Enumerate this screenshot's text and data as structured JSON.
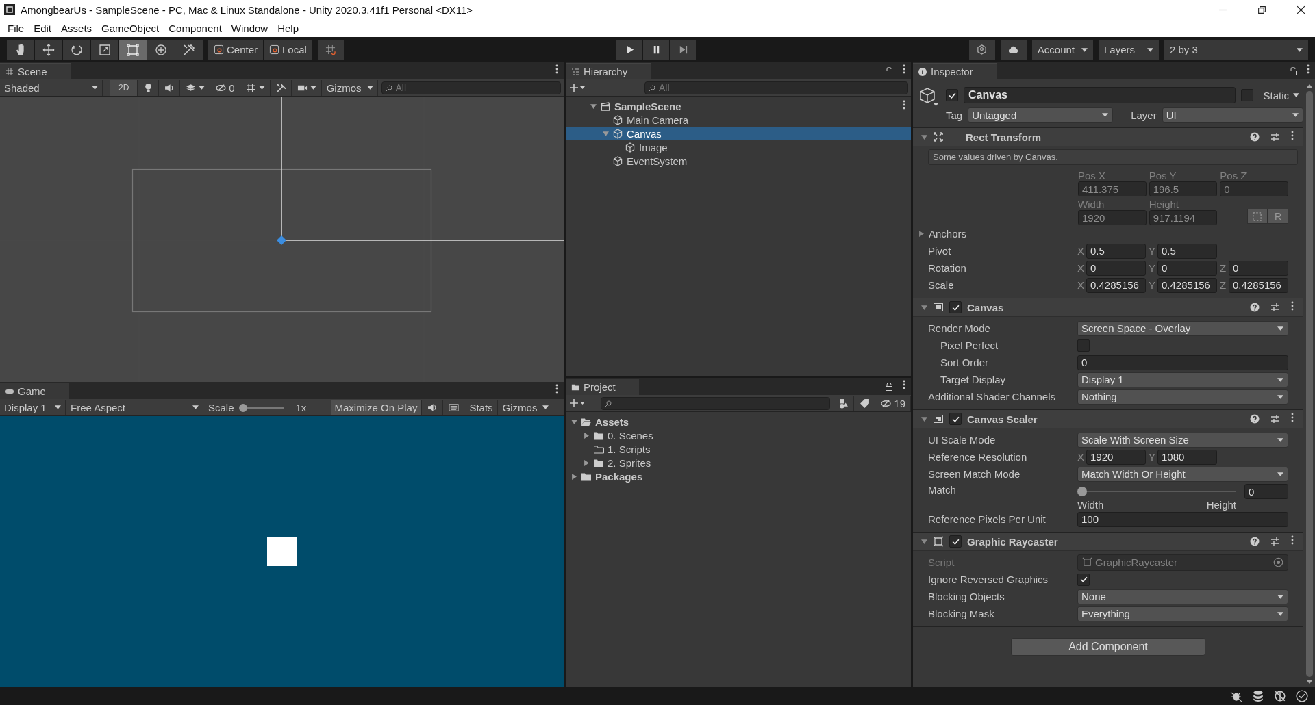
{
  "window": {
    "title": "AmongbearUs - SampleScene - PC, Mac & Linux Standalone - Unity 2020.3.41f1 Personal <DX11>"
  },
  "menu": [
    "File",
    "Edit",
    "Assets",
    "GameObject",
    "Component",
    "Window",
    "Help"
  ],
  "toolbar": {
    "tools": [
      {
        "kind": "hand",
        "selected": false
      },
      {
        "kind": "move",
        "selected": false
      },
      {
        "kind": "rotate",
        "selected": false
      },
      {
        "kind": "scale",
        "selected": false
      },
      {
        "kind": "rect",
        "selected": true
      },
      {
        "kind": "transform",
        "selected": false
      },
      {
        "kind": "custom",
        "selected": false
      }
    ],
    "pivot": [
      "Center",
      "Local"
    ],
    "account": "Account",
    "layers": "Layers",
    "layout": "2 by 3"
  },
  "scene": {
    "tab": "Scene",
    "shading": "Shaded",
    "mode_2d": "2D",
    "hidden_count": "0",
    "gizmos": "Gizmos",
    "search_placeholder": "All"
  },
  "game": {
    "tab": "Game",
    "display": "Display 1",
    "aspect": "Free Aspect",
    "scale_label": "Scale",
    "scale_slider": {
      "level": 0
    },
    "scale_value": "1x",
    "maximize": "Maximize On Play",
    "stats": "Stats",
    "gizmos": "Gizmos"
  },
  "hierarchy": {
    "tab": "Hierarchy",
    "search_placeholder": "All",
    "tree": [
      {
        "label": "SampleScene",
        "kind": "scene",
        "expanded": true,
        "selected": false,
        "children": [
          {
            "label": "Main Camera",
            "kind": "object",
            "selected": false
          },
          {
            "label": "Canvas",
            "kind": "object",
            "expanded": true,
            "selected": true,
            "children": [
              {
                "label": "Image",
                "kind": "object",
                "selected": false
              }
            ]
          },
          {
            "label": "EventSystem",
            "kind": "object",
            "selected": false
          }
        ]
      }
    ]
  },
  "project": {
    "tab": "Project",
    "hidden_count": "19",
    "tree": [
      {
        "label": "Assets",
        "kind": "folder",
        "expanded": true,
        "children": [
          {
            "label": "0. Scenes",
            "kind": "folder",
            "expanded": false
          },
          {
            "label": "1. Scripts",
            "kind": "empty_folder"
          },
          {
            "label": "2. Sprites",
            "kind": "folder",
            "expanded": false
          }
        ]
      },
      {
        "label": "Packages",
        "kind": "folder",
        "expanded": false
      }
    ]
  },
  "inspector": {
    "tab": "Inspector",
    "object": {
      "active": true,
      "name": "Canvas",
      "static": false,
      "static_label": "Static",
      "tag_label": "Tag",
      "tag": "Untagged",
      "layer_label": "Layer",
      "layer": "UI"
    },
    "components": [
      {
        "kind": "rect_transform",
        "title": "Rect Transform",
        "expanded": true,
        "note": "Some values driven by Canvas.",
        "rows": [
          {
            "kind": "grid",
            "cells": [
              {
                "label": "Pos X",
                "value": "411.375"
              },
              {
                "label": "Pos Y",
                "value": "196.5"
              },
              {
                "label": "Pos Z",
                "value": "0"
              },
              {
                "label": "Width",
                "value": "1920"
              },
              {
                "label": "Height",
                "value": "917.1194"
              }
            ],
            "raw_button": "R"
          },
          {
            "kind": "foldout",
            "label": "Anchors",
            "expanded": false
          },
          {
            "kind": "vector",
            "label": "Pivot",
            "axes": [
              {
                "axis": "X",
                "value": "0.5"
              },
              {
                "axis": "Y",
                "value": "0.5"
              }
            ]
          },
          {
            "kind": "vector",
            "label": "Rotation",
            "axes": [
              {
                "axis": "X",
                "value": "0"
              },
              {
                "axis": "Y",
                "value": "0"
              },
              {
                "axis": "Z",
                "value": "0"
              }
            ]
          },
          {
            "kind": "vector",
            "label": "Scale",
            "axes": [
              {
                "axis": "X",
                "value": "0.4285156"
              },
              {
                "axis": "Y",
                "value": "0.4285156"
              },
              {
                "axis": "Z",
                "value": "0.4285156"
              }
            ]
          }
        ]
      },
      {
        "kind": "canvas",
        "title": "Canvas",
        "expanded": true,
        "enabled": true,
        "rows": [
          {
            "kind": "dropdown",
            "label": "Render Mode",
            "value": "Screen Space - Overlay",
            "nested": false
          },
          {
            "kind": "checkbox",
            "label": "Pixel Perfect",
            "checked": false,
            "nested": true
          },
          {
            "kind": "number",
            "label": "Sort Order",
            "value": "0",
            "nested": true
          },
          {
            "kind": "dropdown",
            "label": "Target Display",
            "value": "Display 1",
            "nested": true
          },
          {
            "kind": "dropdown",
            "label": "Additional Shader Channels",
            "value": "Nothing",
            "nested": false
          }
        ]
      },
      {
        "kind": "canvas_scaler",
        "title": "Canvas Scaler",
        "expanded": true,
        "enabled": true,
        "rows": [
          {
            "kind": "dropdown",
            "label": "UI Scale Mode",
            "value": "Scale With Screen Size",
            "nested": false
          },
          {
            "kind": "vector",
            "label": "Reference Resolution",
            "axes": [
              {
                "axis": "X",
                "value": "1920"
              },
              {
                "axis": "Y",
                "value": "1080"
              }
            ]
          },
          {
            "kind": "dropdown",
            "label": "Screen Match Mode",
            "value": "Match Width Or Height",
            "nested": false
          },
          {
            "kind": "slider",
            "label": "Match",
            "level": 0,
            "value": "0",
            "min_label": "Width",
            "max_label": "Height"
          },
          {
            "kind": "number",
            "label": "Reference Pixels Per Unit",
            "value": "100",
            "nested": false
          }
        ]
      },
      {
        "kind": "graphic_raycaster",
        "title": "Graphic Raycaster",
        "expanded": true,
        "enabled": true,
        "rows": [
          {
            "kind": "script",
            "label": "Script",
            "value": "GraphicRaycaster"
          },
          {
            "kind": "checkbox",
            "label": "Ignore Reversed Graphics",
            "checked": true,
            "nested": false
          },
          {
            "kind": "dropdown",
            "label": "Blocking Objects",
            "value": "None",
            "nested": false
          },
          {
            "kind": "dropdown",
            "label": "Blocking Mask",
            "value": "Everything",
            "nested": false
          }
        ]
      }
    ],
    "add_component": "Add Component"
  }
}
